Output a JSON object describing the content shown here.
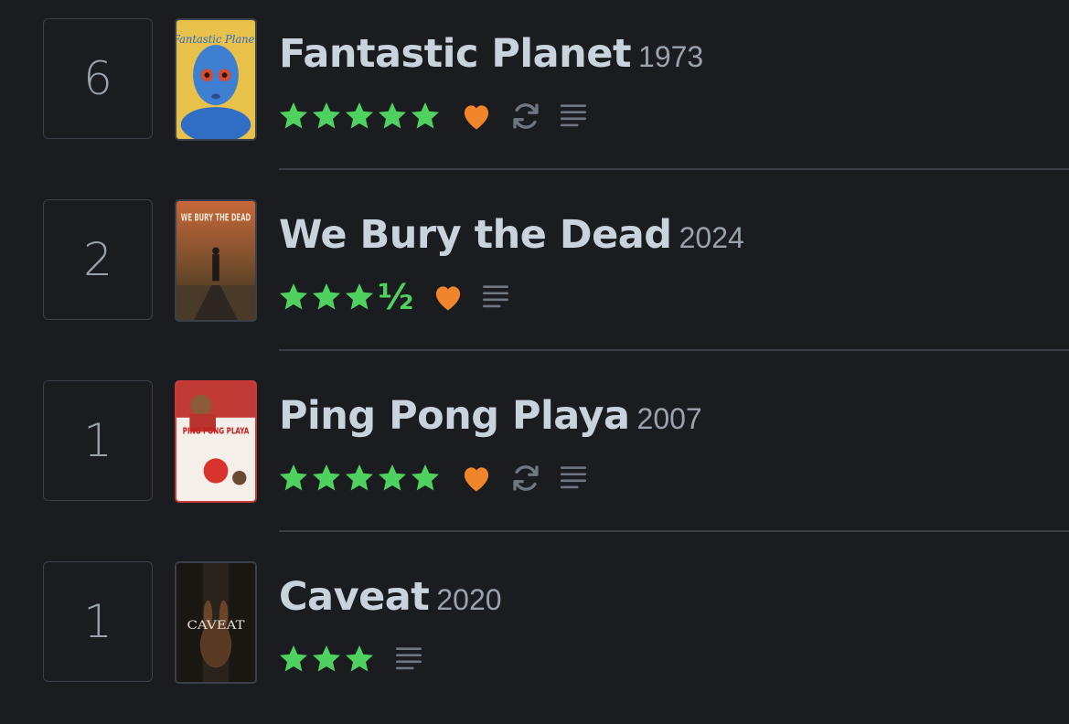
{
  "colors": {
    "background": "#1b1c1f",
    "star": "#4fd160",
    "heart": "#f0852b",
    "icon": "#6e7782",
    "title": "#c9d3dd",
    "year": "#9aa3ad"
  },
  "entries": [
    {
      "day": "6",
      "title": "Fantastic Planet",
      "year": "1973",
      "rating": 5,
      "half_star": "",
      "liked": true,
      "rewatch": true,
      "review": true,
      "poster_icon": "fantastic-planet-poster",
      "poster_text": "Fantastic Planet"
    },
    {
      "day": "2",
      "title": "We Bury the Dead",
      "year": "2024",
      "rating": 3.5,
      "half_star": "½",
      "liked": true,
      "rewatch": false,
      "review": true,
      "poster_icon": "we-bury-the-dead-poster",
      "poster_text": "WE BURY THE DEAD"
    },
    {
      "day": "1",
      "title": "Ping Pong Playa",
      "year": "2007",
      "rating": 5,
      "half_star": "",
      "liked": true,
      "rewatch": true,
      "review": true,
      "poster_icon": "ping-pong-playa-poster",
      "poster_text": "PING PONG PLAYA"
    },
    {
      "day": "1",
      "title": "Caveat",
      "year": "2020",
      "rating": 3,
      "half_star": "",
      "liked": false,
      "rewatch": false,
      "review": true,
      "poster_icon": "caveat-poster",
      "poster_text": "CAVEAT"
    }
  ]
}
